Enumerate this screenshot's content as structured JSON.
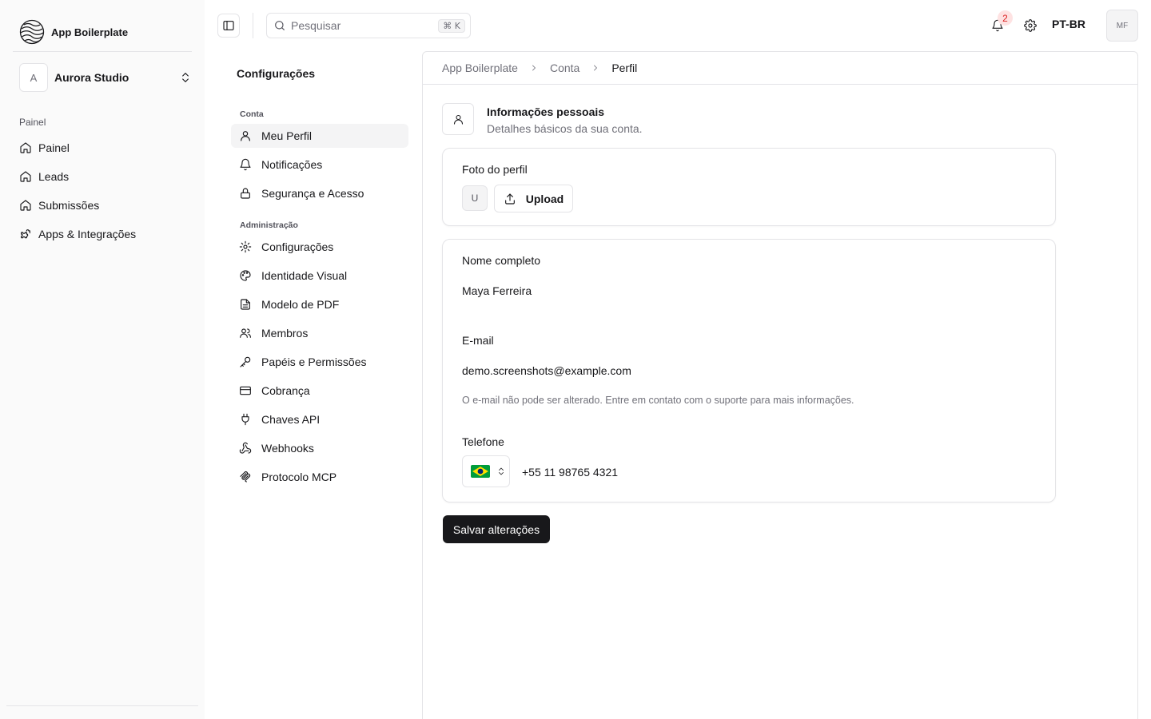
{
  "app": {
    "name": "App Boilerplate"
  },
  "org": {
    "initial": "A",
    "name": "Aurora Studio"
  },
  "sidebar": {
    "group_label": "Painel",
    "items": [
      {
        "label": "Painel",
        "icon": "home-icon"
      },
      {
        "label": "Leads",
        "icon": "home-icon"
      },
      {
        "label": "Submissões",
        "icon": "home-icon"
      },
      {
        "label": "Apps & Integrações",
        "icon": "puzzle-icon"
      }
    ]
  },
  "topbar": {
    "search_placeholder": "Pesquisar",
    "search_shortcut": "⌘ K",
    "notification_count": "2",
    "language": "PT-BR",
    "user_initials": "MF"
  },
  "settings_nav": {
    "title": "Configurações",
    "groups": [
      {
        "label": "Conta",
        "items": [
          {
            "label": "Meu Perfil",
            "icon": "user-icon",
            "active": true
          },
          {
            "label": "Notificações",
            "icon": "bell-icon"
          },
          {
            "label": "Segurança e Acesso",
            "icon": "lock-icon"
          }
        ]
      },
      {
        "label": "Administração",
        "items": [
          {
            "label": "Configurações",
            "icon": "gear-icon"
          },
          {
            "label": "Identidade Visual",
            "icon": "palette-icon"
          },
          {
            "label": "Modelo de PDF",
            "icon": "file-text-icon"
          },
          {
            "label": "Membros",
            "icon": "users-icon"
          },
          {
            "label": "Papéis e Permissões",
            "icon": "key-icon"
          },
          {
            "label": "Cobrança",
            "icon": "credit-card-icon"
          },
          {
            "label": "Chaves API",
            "icon": "plug-icon"
          },
          {
            "label": "Webhooks",
            "icon": "webhook-icon"
          },
          {
            "label": "Protocolo MCP",
            "icon": "mcp-icon"
          }
        ]
      }
    ]
  },
  "breadcrumb": [
    "App Boilerplate",
    "Conta",
    "Perfil"
  ],
  "profile": {
    "section_title": "Informações pessoais",
    "section_subtitle": "Detalhes básicos da sua conta.",
    "photo_label": "Foto do perfil",
    "photo_initial": "U",
    "upload_label": "Upload",
    "name_label": "Nome completo",
    "name_value": "Maya Ferreira",
    "email_label": "E-mail",
    "email_value": "demo.screenshots@example.com",
    "email_help": "O e-mail não pode ser alterado. Entre em contato com o suporte para mais informações.",
    "phone_label": "Telefone",
    "phone_country_flag": "brazil-flag-icon",
    "phone_value": "+55 11 98765 4321",
    "save_label": "Salvar alterações"
  },
  "colors": {
    "primary": "#18181b",
    "sidebar_bg": "#fafafa",
    "border": "#e4e4e7",
    "muted_text": "#71717a",
    "badge_bg": "#fee2e2",
    "badge_text": "#dc2626",
    "flag_green": "#009c3b",
    "flag_yellow": "#ffdf00",
    "flag_blue": "#002776"
  }
}
